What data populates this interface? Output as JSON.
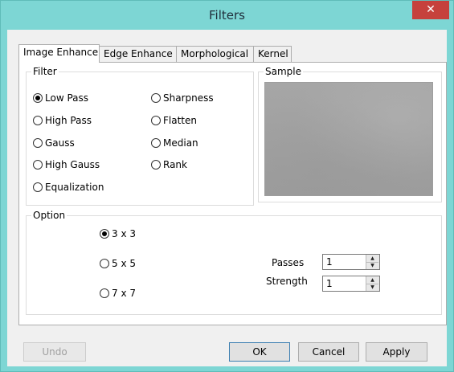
{
  "window": {
    "title": "Filters",
    "close_glyph": "✕"
  },
  "tabs": [
    {
      "label": "Image Enhance",
      "active": true
    },
    {
      "label": "Edge Enhance",
      "active": false
    },
    {
      "label": "Morphological",
      "active": false
    },
    {
      "label": "Kernel",
      "active": false
    }
  ],
  "filter": {
    "legend": "Filter",
    "selected": "Low Pass",
    "options": [
      "Low Pass",
      "High Pass",
      "Gauss",
      "High Gauss",
      "Equalization",
      "Sharpness",
      "Flatten",
      "Median",
      "Rank"
    ]
  },
  "sample": {
    "legend": "Sample"
  },
  "option": {
    "legend": "Option",
    "selected": "3 x 3",
    "kernel_sizes": [
      "3 x 3",
      "5 x 5",
      "7 x 7"
    ],
    "passes_label": "Passes",
    "passes_value": "1",
    "strength_label": "Strength",
    "strength_value": "1"
  },
  "buttons": {
    "undo": "Undo",
    "ok": "OK",
    "cancel": "Cancel",
    "apply": "Apply"
  },
  "icons": {
    "spin_up": "▲",
    "spin_down": "▼"
  },
  "colors": {
    "titlebar": "#7dd6d4",
    "close_button": "#c6413c"
  }
}
